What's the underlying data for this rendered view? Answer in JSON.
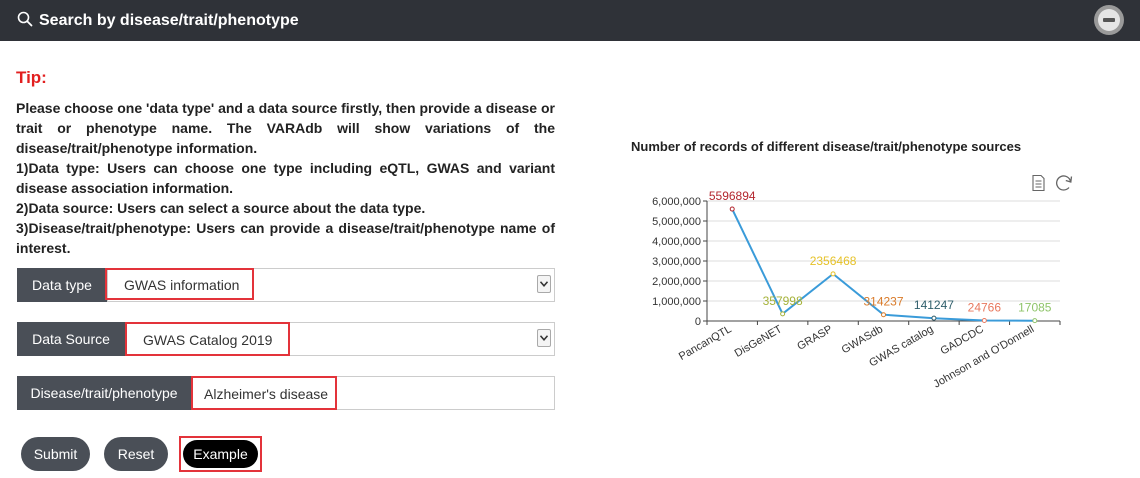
{
  "header": {
    "title": "Search by disease/trait/phenotype",
    "icon": "search-icon"
  },
  "tip": {
    "title": "Tip:",
    "paragraphs": [
      "Please choose one 'data type' and a data source firstly, then provide a disease or trait or phenotype name. The VARAdb will show variations of the disease/trait/phenotype information.",
      "1)Data type: Users can choose one type including eQTL, GWAS and variant disease association information.",
      "2)Data source: Users can select a source about the data type.",
      "3)Disease/trait/phenotype: Users can provide a disease/trait/phenotype name of interest."
    ]
  },
  "form": {
    "data_type": {
      "label": "Data type",
      "value": "GWAS information"
    },
    "data_source": {
      "label": "Data Source",
      "value": "GWAS Catalog 2019"
    },
    "disease": {
      "label": "Disease/trait/phenotype",
      "value": "Alzheimer's disease"
    }
  },
  "buttons": {
    "submit": "Submit",
    "reset": "Reset",
    "example": "Example"
  },
  "colors": {
    "header_bg": "#2f3238",
    "tip_red": "#e21f1f",
    "highlight_red": "#e3333a",
    "button_bg": "#4a4f57",
    "line": "#3a9bd9"
  },
  "chart_data": {
    "type": "line",
    "title": "Number of records of different disease/trait/phenotype sources",
    "categories": [
      "PancanQTL",
      "DisGeNET",
      "GRASP",
      "GWASdb",
      "GWAS catalog",
      "GADCDC",
      "Johnson and O'Donnell"
    ],
    "values": [
      5596894,
      357998,
      2356468,
      314237,
      141247,
      24766,
      17085
    ],
    "value_label_colors": [
      "#b3262e",
      "#a5b23a",
      "#e6c228",
      "#d97b2a",
      "#2f5e6b",
      "#e8785e",
      "#8fc46a"
    ],
    "y_ticks": [
      "0",
      "1,000,000",
      "2,000,000",
      "3,000,000",
      "4,000,000",
      "5,000,000",
      "6,000,000"
    ],
    "ylim": [
      0,
      6000000
    ],
    "grid": true,
    "toolbox": [
      "data-view-icon",
      "restore-icon"
    ]
  }
}
